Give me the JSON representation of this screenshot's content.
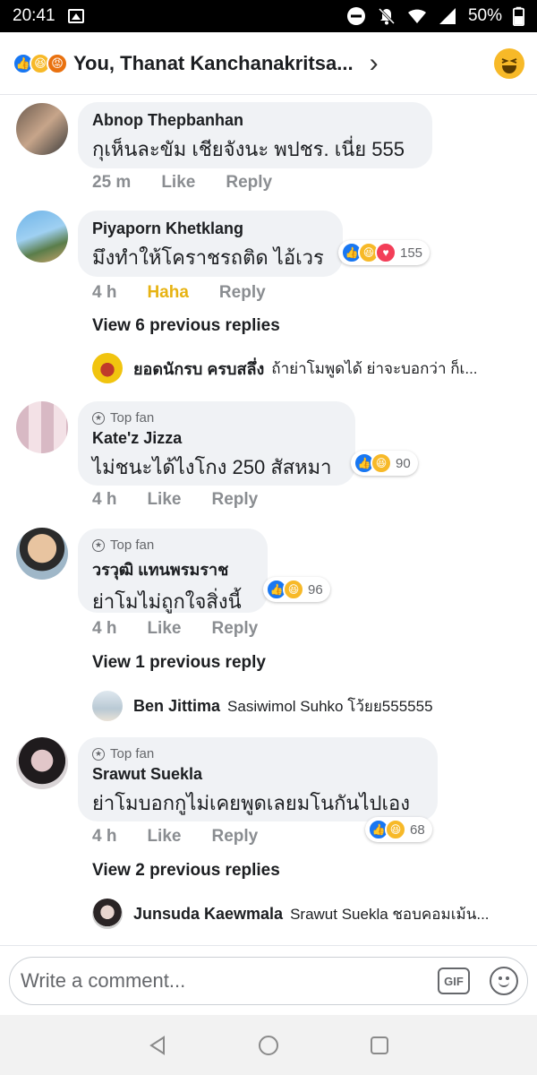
{
  "status_bar": {
    "time": "20:41",
    "battery": "50%"
  },
  "header": {
    "title": "You, Thanat Kanchanakritsa..."
  },
  "comments": [
    {
      "name": "Abnop Thepbanhan",
      "text": "กุเห็นละขัม เชียจังนะ พปชร. เนี่ย 555",
      "time": "25 m",
      "like": "Like",
      "reply": "Reply"
    },
    {
      "name": "Piyaporn Khetklang",
      "text": "มึงทำให้โคราชรถติด ไอ้เวร",
      "time": "4 h",
      "like": "Haha",
      "reply": "Reply",
      "reaction_count": "155",
      "view_prev": "View 6 previous replies",
      "reply_preview": {
        "name": "ยอดนักรบ ครบสลึ่ง",
        "text": "ถ้าย่าโมพูดได้ ย่าจะบอกว่า ก็เ..."
      }
    },
    {
      "badge": "Top fan",
      "name": "Kate'z Jizza",
      "text": "ไม่ชนะได้ไงโกง 250 สัสหมา",
      "time": "4 h",
      "like": "Like",
      "reply": "Reply",
      "reaction_count": "90"
    },
    {
      "badge": "Top fan",
      "name": "วรวุฒิ แทนพรมราช",
      "text": "ย่าโมไม่ถูกใจสิ่งนี้",
      "time": "4 h",
      "like": "Like",
      "reply": "Reply",
      "reaction_count": "96",
      "view_prev": "View 1 previous reply",
      "reply_preview": {
        "name": "Ben Jittima",
        "text": "Sasiwimol Suhko โว้ยย555555"
      }
    },
    {
      "badge": "Top fan",
      "name": "Srawut Suekla",
      "text": "ย่าโมบอกกูไม่เคยพูดเลยมโนกันไปเอง",
      "time": "4 h",
      "like": "Like",
      "reply": "Reply",
      "reaction_count": "68",
      "view_prev": "View 2 previous replies",
      "reply_preview": {
        "name": "Junsuda Kaewmala",
        "text": "Srawut Suekla ชอบคอมเม้น..."
      }
    }
  ],
  "composer": {
    "placeholder": "Write a comment...",
    "gif_label": "GIF"
  },
  "colors": {
    "like_blue": "#1877f2",
    "haha_yellow": "#f7b928",
    "love_red": "#f33e58",
    "angry_orange": "#e9710f",
    "bubble_gray": "#f0f2f5"
  }
}
